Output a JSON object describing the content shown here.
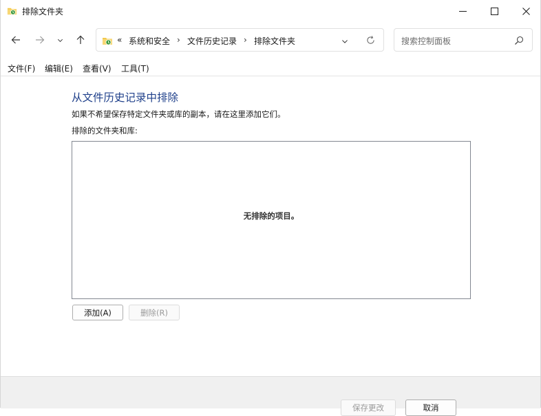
{
  "window": {
    "title": "排除文件夹",
    "app_icon": "file-history-icon",
    "controls": [
      "minimize-icon",
      "maximize-icon",
      "close-icon"
    ]
  },
  "nav": {
    "back_icon": "arrow-left-icon",
    "forward_icon": "arrow-right-icon",
    "recent_icon": "chevron-down-icon",
    "up_icon": "arrow-up-icon"
  },
  "address": {
    "overflow": "«",
    "crumbs": [
      "系统和安全",
      "文件历史记录",
      "排除文件夹"
    ],
    "separator": "›",
    "dropdown_icon": "chevron-down-icon",
    "refresh_icon": "refresh-icon"
  },
  "search": {
    "placeholder": "搜索控制面板",
    "icon": "search-icon"
  },
  "menu": {
    "file": "文件(F)",
    "edit": "编辑(E)",
    "view": "查看(V)",
    "tools": "工具(T)"
  },
  "content": {
    "heading": "从文件历史记录中排除",
    "description": "如果不希望保存特定文件夹或库的副本，请在这里添加它们。",
    "list_label": "排除的文件夹和库:",
    "empty_message": "无排除的项目。",
    "add_button": "添加(A)",
    "remove_button": "删除(R)"
  },
  "footer": {
    "save_button": "保存更改",
    "cancel_button": "取消"
  }
}
